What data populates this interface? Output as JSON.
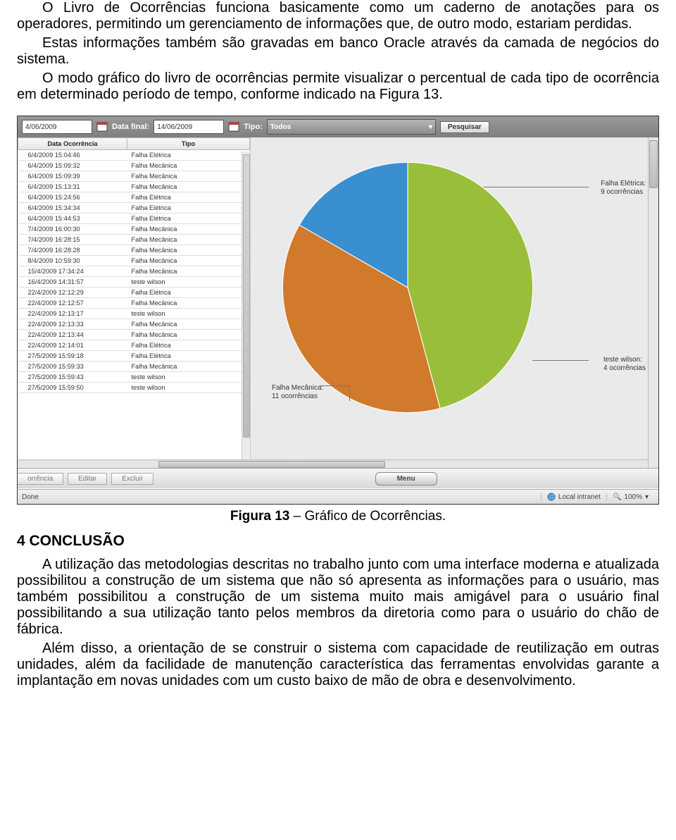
{
  "paragraphs": {
    "p1": "O Livro de Ocorrências funciona basicamente como um caderno de anotações para os operadores, permitindo um gerenciamento de informações que, de outro modo, estariam perdidas.",
    "p2": "Estas informações também são gravadas em banco Oracle através da camada de negócios do sistema.",
    "p3": "O modo gráfico do livro de ocorrências permite visualizar o percentual de cada tipo de ocorrência em determinado período de tempo, conforme indicado na Figura 13."
  },
  "toolbar": {
    "date_start": "4/06/2009",
    "label_data_final": "Data final:",
    "date_end": "14/06/2009",
    "label_tipo": "Tipo:",
    "dropdown_value": "Todos",
    "search_btn": "Pesquisar"
  },
  "table": {
    "col_date": "Data Ocorrência",
    "col_type": "Tipo",
    "rows": [
      {
        "d": "6/4/2009 15:04:46",
        "t": "Falha Elétrica"
      },
      {
        "d": "6/4/2009 15:09:32",
        "t": "Falha Mecânica"
      },
      {
        "d": "6/4/2009 15:09:39",
        "t": "Falha Mecânica"
      },
      {
        "d": "6/4/2009 15:13:31",
        "t": "Falha Mecânica"
      },
      {
        "d": "6/4/2009 15:24:56",
        "t": "Falha Elétrica"
      },
      {
        "d": "6/4/2009 15:34:34",
        "t": "Falha Elétrica"
      },
      {
        "d": "6/4/2009 15:44:53",
        "t": "Falha Elétrica"
      },
      {
        "d": "7/4/2009 16:00:30",
        "t": "Falha Mecânica"
      },
      {
        "d": "7/4/2009 16:28:15",
        "t": "Falha Mecânica"
      },
      {
        "d": "7/4/2009 16:28:28",
        "t": "Falha Mecânica"
      },
      {
        "d": "8/4/2009 10:59:30",
        "t": "Falha Mecânica"
      },
      {
        "d": "15/4/2009 17:34:24",
        "t": "Falha Mecânica"
      },
      {
        "d": "16/4/2009 14:31:57",
        "t": "teste wilson"
      },
      {
        "d": "22/4/2009 12:12:29",
        "t": "Falha Elétrica"
      },
      {
        "d": "22/4/2009 12:12:57",
        "t": "Falha Mecânica"
      },
      {
        "d": "22/4/2009 12:13:17",
        "t": "teste wilson"
      },
      {
        "d": "22/4/2009 12:13:33",
        "t": "Falha Mecânica"
      },
      {
        "d": "22/4/2009 12:13:44",
        "t": "Falha Mecânica"
      },
      {
        "d": "22/4/2009 12:14:01",
        "t": "Falha Elétrica"
      },
      {
        "d": "27/5/2009 15:59:18",
        "t": "Falha Elétrica"
      },
      {
        "d": "27/5/2009 15:59:33",
        "t": "Falha Mecânica"
      },
      {
        "d": "27/5/2009 15:59:43",
        "t": "teste wilson"
      },
      {
        "d": "27/5/2009 15:59:50",
        "t": "teste wilson"
      }
    ]
  },
  "chart_labels": {
    "eletrica_l1": "Falha Elétrica:",
    "eletrica_l2": "9 ocorrências",
    "mecanica_l1": "Falha Mecânica:",
    "mecanica_l2": "11 ocorrências",
    "wilson_l1": "teste wilson:",
    "wilson_l2": "4 ocorrências"
  },
  "chart_data": {
    "type": "pie",
    "title": "",
    "series": [
      {
        "name": "Falha Mecânica",
        "value": 11,
        "color": "#99bf3a"
      },
      {
        "name": "Falha Elétrica",
        "value": 9,
        "color": "#d17a2b"
      },
      {
        "name": "teste wilson",
        "value": 4,
        "color": "#3a8fd1"
      }
    ]
  },
  "footer": {
    "tab_orrencia": "orrência",
    "tab_editar": "Editar",
    "tab_excluir": "Excluir",
    "menu": "Menu",
    "done": "Done",
    "intranet": "Local intranet",
    "zoom": "100%"
  },
  "caption_bold": "Figura 13",
  "caption_rest": " – Gráfico de Ocorrências.",
  "section_heading": "4  CONCLUSÃO",
  "conclusion": {
    "p1": "A utilização das metodologias descritas no trabalho junto com uma interface moderna e atualizada possibilitou a construção de um sistema que não só apresenta as informações para o usuário, mas também possibilitou a construção de um sistema muito mais amigável para o usuário final possibilitando a sua utilização tanto pelos membros da diretoria como para o usuário do chão de fábrica.",
    "p2": "Além disso, a orientação de se construir o sistema com capacidade de reutilização em outras unidades, além da facilidade de manutenção característica das ferramentas envolvidas garante a implantação em novas unidades com um custo baixo de mão de obra e desenvolvimento."
  }
}
